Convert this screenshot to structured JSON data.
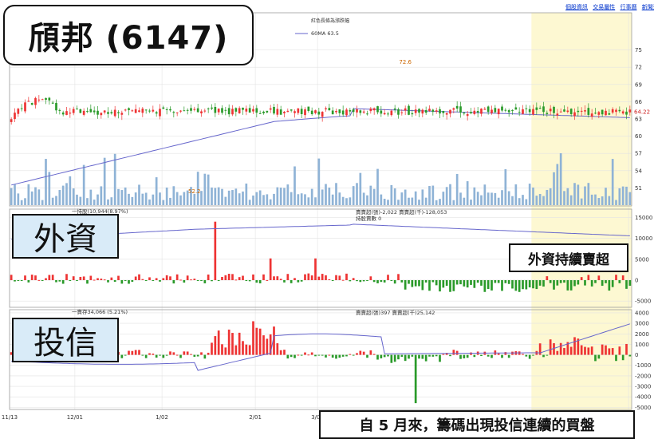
{
  "nav_links": [
    "個股資訊",
    "交易屬性",
    "行事曆",
    "新聞通"
  ],
  "overlays": {
    "stock_title": "頎邦 (6147)",
    "foreign_label": "外資",
    "trust_label": "投信",
    "foreign_note": "外資持續賣超",
    "trust_note": "自 5 月來，籌碼出現投信連續的買盤"
  },
  "colors": {
    "up": "#ee3333",
    "down": "#2a9a2a",
    "ma": "#6666cc",
    "volume": "#8fb3d6",
    "highlight": "#fdf8d2",
    "grid": "#e3e3e3",
    "border": "#9e9e9e"
  },
  "chart_data": [
    {
      "type": "candlestick",
      "legend": "紅色長條為漲跌幅",
      "ma_label": "60MA 63.5",
      "last_price": "64.22",
      "high_label": "72.6",
      "low_label": "52.2",
      "y_ticks": [
        75,
        72,
        69,
        66,
        63,
        60,
        57,
        54,
        51
      ],
      "ylim": [
        48,
        77
      ],
      "x_ticks": [
        "11/13",
        "12/01",
        "1/02",
        "2/01",
        "3/01",
        "6/19"
      ],
      "highlight_from_bar": 151
    },
    {
      "type": "bar",
      "panel_label": "外資",
      "legend_text": "賣賣超(張)-2,022 賣賣超(千)-128,053",
      "legend_text2": "持股賣數 0",
      "stats_text": "一持股(10,944(8.97%)",
      "y_ticks": [
        15000,
        10000,
        5000,
        0,
        -5000
      ],
      "ylim": [
        -6500,
        17000
      ]
    },
    {
      "type": "bar",
      "panel_label": "投信",
      "legend_text": "賣賣超(張)397 賣賣超(千)25,142",
      "stats_text": "一賣存34,066 (5.21%)",
      "y_ticks": [
        4000,
        3000,
        2000,
        1000,
        0,
        -1000,
        -2000,
        -3000,
        -4000,
        -5000
      ],
      "ylim": [
        -5200,
        4300
      ]
    }
  ]
}
